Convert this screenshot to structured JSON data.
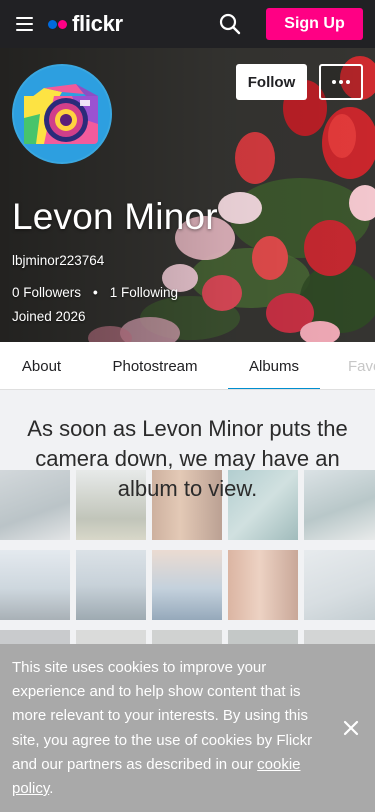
{
  "nav": {
    "logo_text": "flickr",
    "signup_label": "Sign Up"
  },
  "colors": {
    "nav_bg": "#212124",
    "brand_pink": "#ff0084",
    "brand_blue": "#006add",
    "tab_active": "#008ecf",
    "cookie_bg": "#a9a9a9"
  },
  "icons": {
    "menu": "hamburger-menu-icon",
    "search": "search-icon",
    "more": "more-dots-icon",
    "close": "close-icon"
  },
  "profile": {
    "follow_label": "Follow",
    "name": "Levon Minor",
    "username": "lbjminor223764",
    "followers": "0 Followers",
    "separator": "•",
    "following": "1 Following",
    "joined": "Joined 2026"
  },
  "tabs": [
    {
      "label": "About"
    },
    {
      "label": "Photostream"
    },
    {
      "label": "Albums",
      "active": true
    },
    {
      "label": "Fave"
    }
  ],
  "albums": {
    "empty_message": "As soon as Levon Minor puts the camera down, we may have an album to view."
  },
  "cookie_banner": {
    "text": "This site uses cookies to improve your experience and to help show content that is more relevant to your interests. By using this site, you agree to the use of cookies by Flickr and our partners as described in our ",
    "link_text": "cookie policy",
    "trailing": "."
  }
}
